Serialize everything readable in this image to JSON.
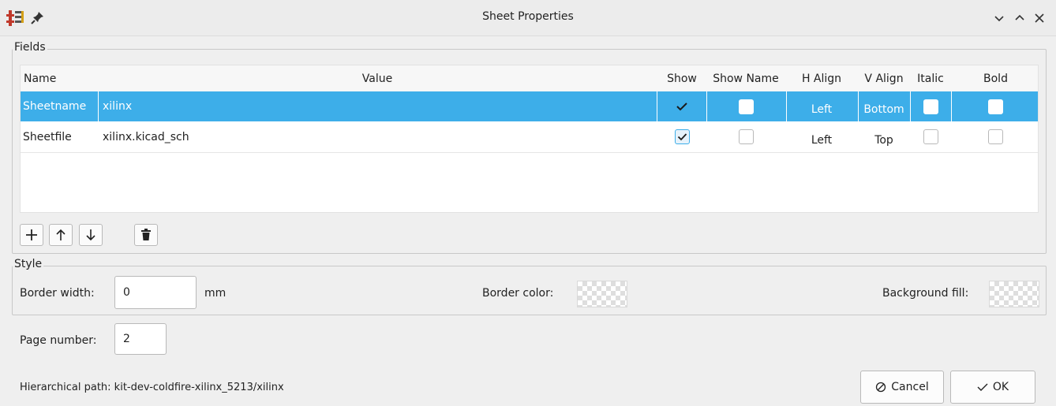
{
  "window": {
    "title": "Sheet Properties",
    "icons": {
      "app": "kicad-eeschema-icon",
      "pin": "pin-icon",
      "minimize": "chevron-down-icon",
      "maximize": "chevron-up-icon",
      "close": "close-icon"
    }
  },
  "fields": {
    "group_label": "Fields",
    "columns": [
      "Name",
      "Value",
      "Show",
      "Show Name",
      "H Align",
      "V Align",
      "Italic",
      "Bold"
    ],
    "rows": [
      {
        "name": "Sheetname",
        "value": "xilinx",
        "show": true,
        "show_name": false,
        "h_align": "Left",
        "v_align": "Bottom",
        "italic": false,
        "bold": false,
        "selected": true
      },
      {
        "name": "Sheetfile",
        "value": "xilinx.kicad_sch",
        "show": true,
        "show_name": false,
        "h_align": "Left",
        "v_align": "Top",
        "italic": false,
        "bold": false,
        "selected": false
      }
    ],
    "buttons": {
      "add": "plus-icon",
      "up": "arrow-up-icon",
      "down": "arrow-down-icon",
      "delete": "trash-icon"
    }
  },
  "style": {
    "group_label": "Style",
    "border_width_label": "Border width:",
    "border_width_value": "0",
    "border_width_unit": "mm",
    "border_color_label": "Border color:",
    "background_fill_label": "Background fill:"
  },
  "page": {
    "label": "Page number:",
    "value": "2"
  },
  "footer": {
    "hierarchical_path": "Hierarchical path: kit-dev-coldfire-xilinx_5213/xilinx",
    "cancel_label": "Cancel",
    "ok_label": "OK"
  }
}
